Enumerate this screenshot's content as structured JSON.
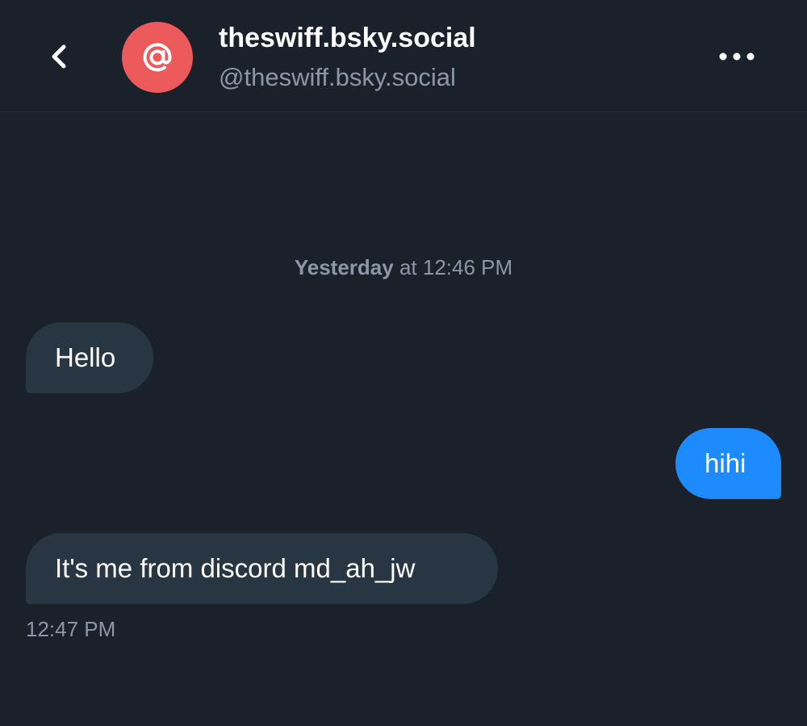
{
  "header": {
    "back_icon": "chevron-left-icon",
    "avatar_icon": "at-sign-icon",
    "avatar_color": "#ec5a5b",
    "display_name": "theswiff.bsky.social",
    "handle": "@theswiff.bsky.social",
    "more_icon": "more-horizontal-icon"
  },
  "conversation": {
    "date_separator": {
      "day": "Yesterday",
      "time": "at 12:46 PM"
    },
    "messages": [
      {
        "direction": "received",
        "text": "Hello"
      },
      {
        "direction": "sent",
        "text": "hihi"
      },
      {
        "direction": "received",
        "text": "It's me from discord md_ah_jw",
        "timestamp": "12:47 PM"
      }
    ]
  },
  "colors": {
    "background": "#1b212b",
    "received_bubble": "#283543",
    "sent_bubble": "#1d8bfd",
    "muted_text": "#8b97a8"
  }
}
